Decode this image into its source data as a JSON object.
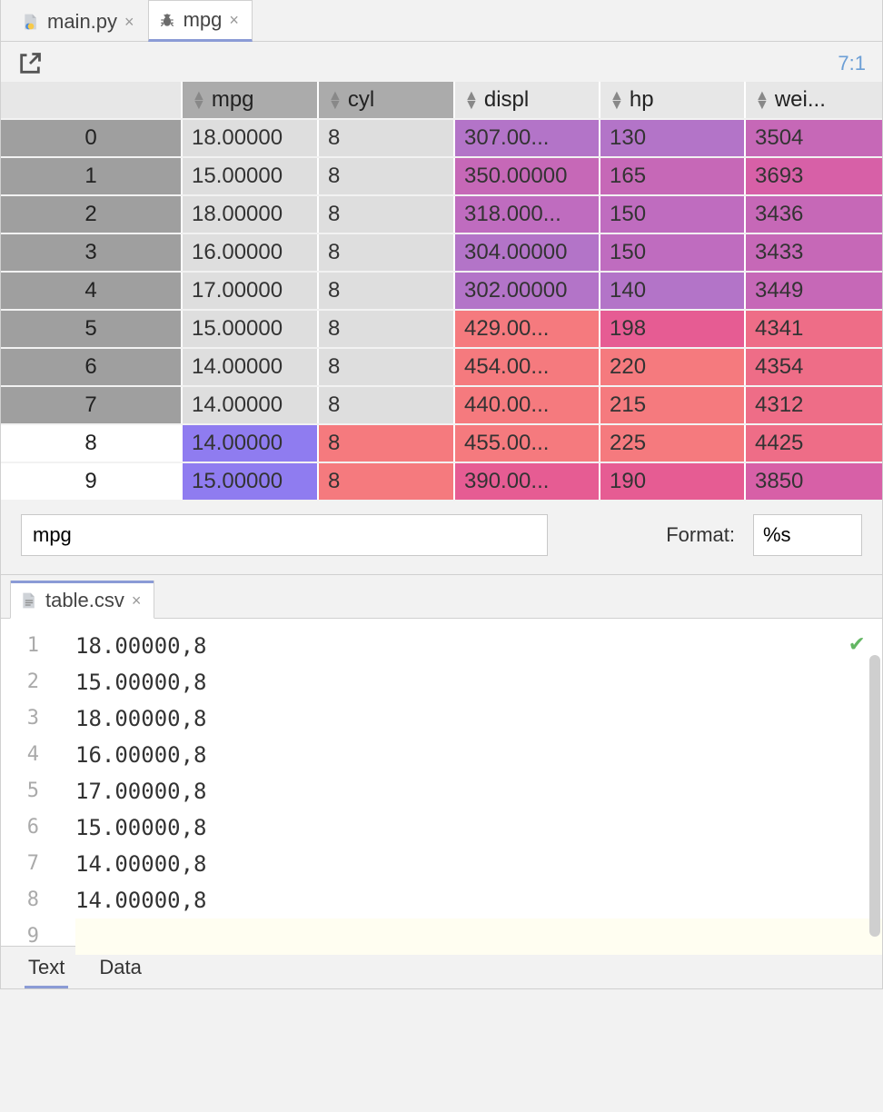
{
  "tabs_upper": [
    {
      "label": "main.py",
      "active": false,
      "icon": "python"
    },
    {
      "label": "mpg",
      "active": true,
      "icon": "bug"
    }
  ],
  "cursor_position": "7:1",
  "columns": [
    "mpg",
    "cyl",
    "displ",
    "hp",
    "wei..."
  ],
  "rows": [
    {
      "idx": "0",
      "sel": true,
      "mpg": "18.00000",
      "cyl": "8",
      "displ": "307.00...",
      "hp": "130",
      "wei": "3504",
      "c_mpg": "#dedede",
      "c_cyl": "#dedede",
      "c_displ": "#b374c8",
      "c_hp": "#b374c8",
      "c_wei": "#c668b7"
    },
    {
      "idx": "1",
      "sel": true,
      "mpg": "15.00000",
      "cyl": "8",
      "displ": "350.00000",
      "hp": "165",
      "wei": "3693",
      "c_mpg": "#dedede",
      "c_cyl": "#dedede",
      "c_displ": "#c668b7",
      "c_hp": "#c668b7",
      "c_wei": "#d760a7"
    },
    {
      "idx": "2",
      "sel": true,
      "mpg": "18.00000",
      "cyl": "8",
      "displ": "318.000...",
      "hp": "150",
      "wei": "3436",
      "c_mpg": "#dedede",
      "c_cyl": "#dedede",
      "c_displ": "#bf6cbf",
      "c_hp": "#bf6cbf",
      "c_wei": "#c668b7"
    },
    {
      "idx": "3",
      "sel": true,
      "mpg": "16.00000",
      "cyl": "8",
      "displ": "304.00000",
      "hp": "150",
      "wei": "3433",
      "c_mpg": "#dedede",
      "c_cyl": "#dedede",
      "c_displ": "#b374c8",
      "c_hp": "#bf6cbf",
      "c_wei": "#c668b7"
    },
    {
      "idx": "4",
      "sel": true,
      "mpg": "17.00000",
      "cyl": "8",
      "displ": "302.00000",
      "hp": "140",
      "wei": "3449",
      "c_mpg": "#dedede",
      "c_cyl": "#dedede",
      "c_displ": "#b374c8",
      "c_hp": "#b374c8",
      "c_wei": "#c668b7"
    },
    {
      "idx": "5",
      "sel": true,
      "mpg": "15.00000",
      "cyl": "8",
      "displ": "429.00...",
      "hp": "198",
      "wei": "4341",
      "c_mpg": "#dedede",
      "c_cyl": "#dedede",
      "c_displ": "#f57a7e",
      "c_hp": "#e65c93",
      "c_wei": "#ee6d87"
    },
    {
      "idx": "6",
      "sel": true,
      "mpg": "14.00000",
      "cyl": "8",
      "displ": "454.00...",
      "hp": "220",
      "wei": "4354",
      "c_mpg": "#dedede",
      "c_cyl": "#dedede",
      "c_displ": "#f57a7e",
      "c_hp": "#f57a7e",
      "c_wei": "#ee6d87"
    },
    {
      "idx": "7",
      "sel": true,
      "mpg": "14.00000",
      "cyl": "8",
      "displ": "440.00...",
      "hp": "215",
      "wei": "4312",
      "c_mpg": "#dedede",
      "c_cyl": "#dedede",
      "c_displ": "#f57a7e",
      "c_hp": "#f57a7e",
      "c_wei": "#ee6d87"
    },
    {
      "idx": "8",
      "sel": false,
      "mpg": "14.00000",
      "cyl": "8",
      "displ": "455.00...",
      "hp": "225",
      "wei": "4425",
      "c_mpg": "#8f7cf0",
      "c_cyl": "#f57a7e",
      "c_displ": "#f57a7e",
      "c_hp": "#f57a7e",
      "c_wei": "#ee6d87"
    },
    {
      "idx": "9",
      "sel": false,
      "mpg": "15.00000",
      "cyl": "8",
      "displ": "390.00...",
      "hp": "190",
      "wei": "3850",
      "c_mpg": "#8f7cf0",
      "c_cyl": "#f57a7e",
      "c_displ": "#e65c93",
      "c_hp": "#e65c93",
      "c_wei": "#d760a7"
    }
  ],
  "filter_value": "mpg",
  "format_label": "Format:",
  "format_value": "%s",
  "editor": {
    "tab_label": "table.csv",
    "lines": [
      "18.00000,8",
      "15.00000,8",
      "18.00000,8",
      "16.00000,8",
      "17.00000,8",
      "15.00000,8",
      "14.00000,8",
      "14.00000,8",
      ""
    ],
    "bottom_tabs": [
      "Text",
      "Data"
    ],
    "bottom_active": "Text"
  }
}
